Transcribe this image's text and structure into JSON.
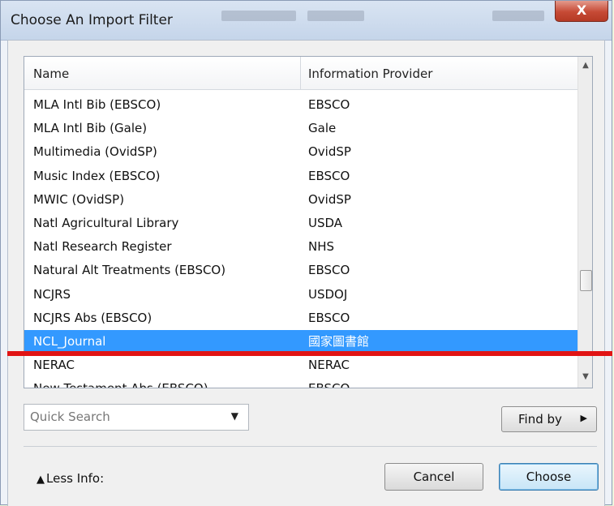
{
  "window": {
    "title": "Choose An Import Filter",
    "close_label": "X"
  },
  "list": {
    "columns": [
      "Name",
      "Information Provider"
    ],
    "rows": [
      {
        "name": "MLA Intl Bib (EBSCO)",
        "provider": "EBSCO"
      },
      {
        "name": "MLA Intl Bib (Gale)",
        "provider": "Gale"
      },
      {
        "name": "Multimedia (OvidSP)",
        "provider": "OvidSP"
      },
      {
        "name": "Music Index (EBSCO)",
        "provider": "EBSCO"
      },
      {
        "name": "MWIC (OvidSP)",
        "provider": "OvidSP"
      },
      {
        "name": "Natl Agricultural Library",
        "provider": "USDA"
      },
      {
        "name": "Natl Research Register",
        "provider": "NHS"
      },
      {
        "name": "Natural Alt Treatments (EBSCO)",
        "provider": "EBSCO"
      },
      {
        "name": "NCJRS",
        "provider": "USDOJ"
      },
      {
        "name": "NCJRS Abs (EBSCO)",
        "provider": "EBSCO"
      },
      {
        "name": "NCL_Journal",
        "provider": "國家圖書館",
        "selected": true
      },
      {
        "name": "NERAC",
        "provider": "NERAC"
      },
      {
        "name": "New Testament Abs (EBSCO)",
        "provider": "EBSCO"
      }
    ]
  },
  "search": {
    "placeholder": "Quick Search"
  },
  "find_by_label": "Find by",
  "less_info_label": "Less Info:",
  "cancel_label": "Cancel",
  "choose_label": "Choose",
  "colors": {
    "selection": "#3399ff",
    "annotation_line": "#e11414"
  }
}
